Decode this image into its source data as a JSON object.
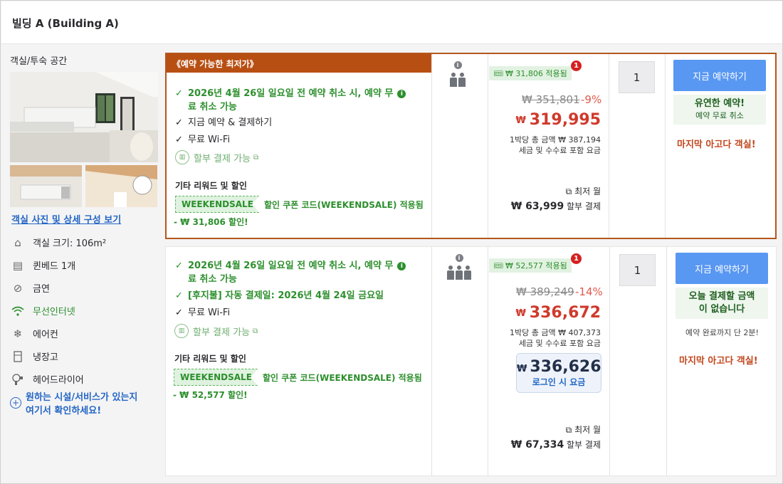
{
  "header": {
    "title": "빌딩 A (Building A)"
  },
  "room": {
    "section_label": "객실/투숙 공간",
    "details_link": "객실 사진 및 상세 구성 보기",
    "features": [
      {
        "icon": "house-size-icon",
        "label": "객실 크기: 106m²"
      },
      {
        "icon": "bed-icon",
        "label": "퀸베드 1개"
      },
      {
        "icon": "no-smoking-icon",
        "label": "금연"
      },
      {
        "icon": "wifi-icon",
        "label": "무선인터넷"
      },
      {
        "icon": "snowflake-icon",
        "label": "에어컨"
      },
      {
        "icon": "fridge-icon",
        "label": "냉장고"
      },
      {
        "icon": "hairdryer-icon",
        "label": "헤어드라이어"
      }
    ],
    "ask_link_line1": "원하는 시설/서비스가 있는지",
    "ask_link_line2": "여기서 확인하세요!"
  },
  "offers": [
    {
      "top_badge": "《예약 가능한 최저가》",
      "cancel_line1": "2026년 4월 26일 일요일 전 예약 취소 시, 예약 무",
      "cancel_line2": "료 취소 가능",
      "book_now_pay": "지금 예약 & 결제하기",
      "wifi": "무료 Wi-Fi",
      "installment": "할부 결제 가능",
      "other_title": "기타 리워드 및 할인",
      "coupon_code": "WEEKENDSALE",
      "coupon_text": "할인 쿠폰 코드(WEEKENDSALE) 적용됨",
      "discount_text": "- ₩ 31,806 할인!",
      "applied": "₩ 31,806 적용됨",
      "badge_count": "1",
      "original_price": "₩ 351,801",
      "discount_pct": "-9%",
      "currency": "₩",
      "price": "319,995",
      "per_night": "1박당 총 금액 ₩ 387,194",
      "tax_note": "세금 및 수수료 포함 요금",
      "monthly_label": "최저 월",
      "monthly_amount": "₩ 63,999",
      "monthly_suffix": "할부 결제",
      "quantity": "1",
      "book_button": "지금 예약하기",
      "flex_title": "유연한 예약!",
      "flex_sub": "예약 무료 취소",
      "last_room": "마지막 아고다 객실!"
    },
    {
      "cancel_line1": "2026년 4월 26일 일요일 전 예약 취소 시, 예약 무",
      "cancel_line2": "료 취소 가능",
      "autopay": "[후지불] 자동 결제일: 2026년 4월 24일 금요일",
      "wifi": "무료 Wi-Fi",
      "installment": "할부 결제 가능",
      "other_title": "기타 리워드 및 할인",
      "coupon_code": "WEEKENDSALE",
      "coupon_text": "할인 쿠폰 코드(WEEKENDSALE) 적용됨",
      "discount_text": "- ₩ 52,577 할인!",
      "applied": "₩ 52,577 적용됨",
      "badge_count": "1",
      "original_price": "₩ 389,249",
      "discount_pct": "-14%",
      "currency": "₩",
      "price": "336,672",
      "per_night": "1박당 총 금액 ₩ 407,373",
      "tax_note": "세금 및 수수료 포함 요금",
      "login_price": "336,626",
      "login_label": "로그인 시 요금",
      "monthly_label": "최저 월",
      "monthly_amount": "₩ 67,334",
      "monthly_suffix": "할부 결제",
      "quantity": "1",
      "book_button": "지금 예약하기",
      "pay_title_line1": "오늘 결제할 금액",
      "pay_title_line2": "이 없습니다",
      "remain": "예약 완료까지 단 2분!",
      "last_room": "마지막 아고다 객실!"
    }
  ],
  "colors": {
    "accent_orange": "#b84f12",
    "green": "#2d8f2d",
    "blue": "#5897f2",
    "red": "#cf3a2c"
  }
}
